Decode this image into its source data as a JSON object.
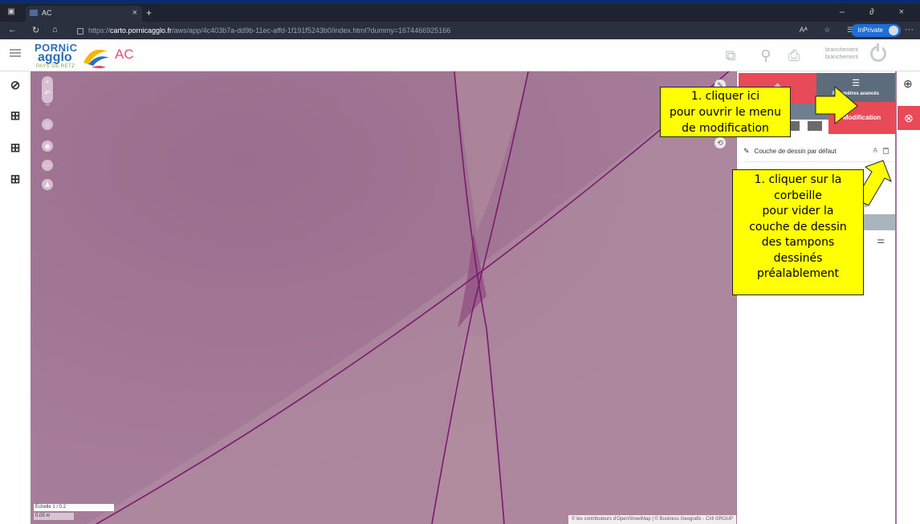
{
  "browser": {
    "tab_title": "AC",
    "url_prefix": "https://",
    "url_host": "carto.pornicagglo.fr",
    "url_path": "/aws/app/4c403b7a-dd9b-11ec-affd-1f191f5243b0/index.html?dummy=1674466925166",
    "inprivate_label": "InPrivate",
    "new_tab": "+",
    "close_tab": "×",
    "win_controls": "– ∂ ×"
  },
  "header": {
    "logo_pornic": "PORNiC",
    "logo_agglo": "agglo",
    "logo_retz": "PAYS DE RETZ",
    "app_name": "AC",
    "branch_line1": "branchement",
    "branch_line2": "branchement"
  },
  "map": {
    "scale_label": "Échelle 1 / 0.2",
    "scale_bar": "0.05 m",
    "attribution": "© les contributeurs d'OpenStreetMap | © Business Geografic - Ciril GROUP"
  },
  "panel": {
    "tab_advanced_label": "Paramètres avancés",
    "layer_name": "Couche de dessin par défaut",
    "layer_badge": "A",
    "partial_text": "nt",
    "modification_label": "Modification"
  },
  "annotations": {
    "callout1_lines": [
      "1. cliquer ici",
      "pour ouvrir le menu",
      "de modification"
    ],
    "callout2_lines": [
      "1. cliquer sur la",
      "corbeille",
      "pour vider la",
      "couche de dessin",
      "des tampons",
      "dessinés",
      "préalablement"
    ]
  },
  "colors": {
    "accent_red": "#e84a57",
    "panel_slate": "#5c6c7c",
    "map_purple": "#a27a95",
    "callout_yellow": "#ffff00"
  }
}
